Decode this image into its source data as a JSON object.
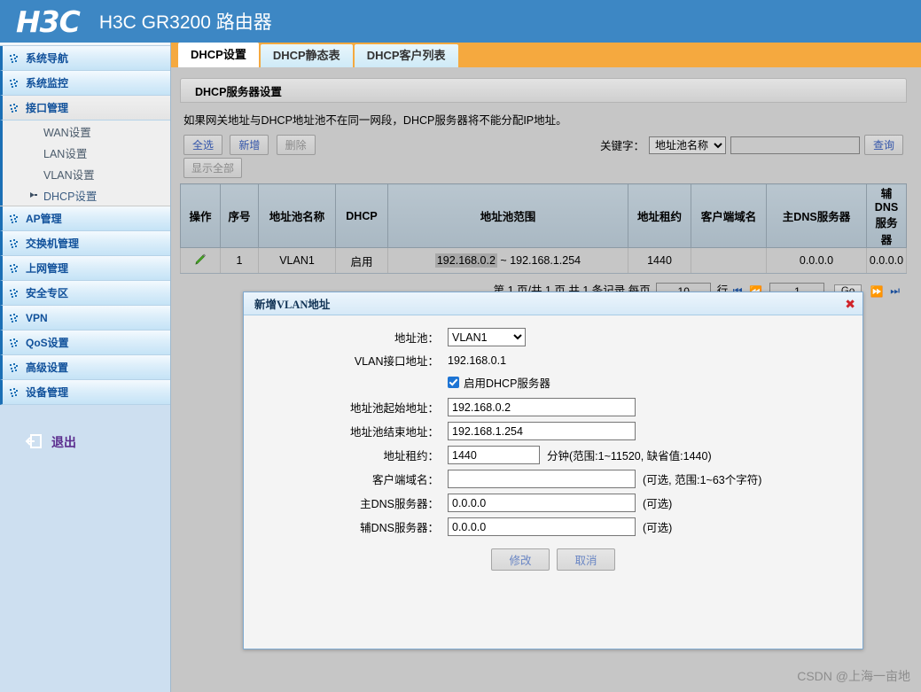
{
  "header": {
    "logo": "H3C",
    "title": "H3C GR3200 路由器",
    "brand_color": "#3d87c4"
  },
  "sidebar": {
    "items": [
      {
        "label": "系统导航",
        "icon": "dots-bullet-icon",
        "expanded": false
      },
      {
        "label": "系统监控",
        "icon": "dots-bullet-icon",
        "expanded": false
      },
      {
        "label": "接口管理",
        "icon": "dots-bullet-icon",
        "expanded": true
      }
    ],
    "sub_items": [
      {
        "label": "WAN设置",
        "current": false
      },
      {
        "label": "LAN设置",
        "current": false
      },
      {
        "label": "VLAN设置",
        "current": false
      },
      {
        "label": "DHCP设置",
        "current": true,
        "marker": "arrow-right-icon"
      }
    ],
    "items_after": [
      {
        "label": "AP管理",
        "icon": "dots-bullet-icon"
      },
      {
        "label": "交换机管理",
        "icon": "dots-bullet-icon"
      },
      {
        "label": "上网管理",
        "icon": "dots-bullet-icon"
      },
      {
        "label": "安全专区",
        "icon": "dots-bullet-icon"
      },
      {
        "label": "VPN",
        "icon": "dots-bullet-icon"
      },
      {
        "label": "QoS设置",
        "icon": "dots-bullet-icon"
      },
      {
        "label": "高级设置",
        "icon": "dots-bullet-icon"
      },
      {
        "label": "设备管理",
        "icon": "dots-bullet-icon"
      }
    ],
    "logout": {
      "label": "退出",
      "icon": "exit-icon",
      "color": "#5b2d8e"
    }
  },
  "tabs": [
    {
      "label": "DHCP设置",
      "active": true
    },
    {
      "label": "DHCP静态表",
      "active": false
    },
    {
      "label": "DHCP客户列表",
      "active": false
    }
  ],
  "panel": {
    "title": "DHCP服务器设置",
    "note": "如果网关地址与DHCP地址池不在同一网段，DHCP服务器将不能分配IP地址。"
  },
  "toolbar": {
    "select_all": "全选",
    "add": "新增",
    "delete": "删除",
    "show_all": "显示全部",
    "keyword_label": "关键字：",
    "keyword_option": "地址池名称",
    "keyword_value": "",
    "query": "查询"
  },
  "table": {
    "headers": [
      "操作",
      "序号",
      "地址池名称",
      "DHCP",
      "地址池范围",
      "地址租约",
      "客户端域名",
      "主DNS服务器",
      "辅DNS服务器"
    ],
    "rows": [
      {
        "action_icon": "edit-pencil-icon",
        "index": "1",
        "pool_name": "VLAN1",
        "dhcp": "启用",
        "range_start": "192.168.0.2",
        "range_sep": "~",
        "range_end": "192.168.1.254",
        "lease": "1440",
        "client_domain": "",
        "dns_primary": "0.0.0.0",
        "dns_secondary": "0.0.0.0"
      }
    ]
  },
  "pager": {
    "summary_1": "第 1 页/共 1 页 共 1 条记录 每页",
    "page_size": "10",
    "summary_2": "行",
    "current_page": "1",
    "go": "Go",
    "first_icon": "first-page-icon",
    "prev_icon": "prev-page-icon",
    "next_icon": "next-page-icon",
    "last_icon": "last-page-icon"
  },
  "modal": {
    "title": "新增VLAN地址",
    "close_icon": "close-icon",
    "fields": {
      "pool_label": "地址池：",
      "pool_value": "VLAN1",
      "vlan_iface_label": "VLAN接口地址：",
      "vlan_iface_value": "192.168.0.1",
      "enable_dhcp_label": "启用DHCP服务器",
      "enable_dhcp_checked": true,
      "start_label": "地址池起始地址：",
      "start_value": "192.168.0.2",
      "end_label": "地址池结束地址：",
      "end_value": "192.168.1.254",
      "lease_label": "地址租约：",
      "lease_value": "1440",
      "lease_hint": "分钟(范围:1~11520, 缺省值:1440)",
      "domain_label": "客户端域名：",
      "domain_value": "",
      "domain_hint": "(可选, 范围:1~63个字符)",
      "dns1_label": "主DNS服务器：",
      "dns1_value": "0.0.0.0",
      "dns1_hint": "(可选)",
      "dns2_label": "辅DNS服务器：",
      "dns2_value": "0.0.0.0",
      "dns2_hint": "(可选)"
    },
    "actions": {
      "submit": "修改",
      "cancel": "取消"
    }
  },
  "watermark": "CSDN @上海一亩地"
}
